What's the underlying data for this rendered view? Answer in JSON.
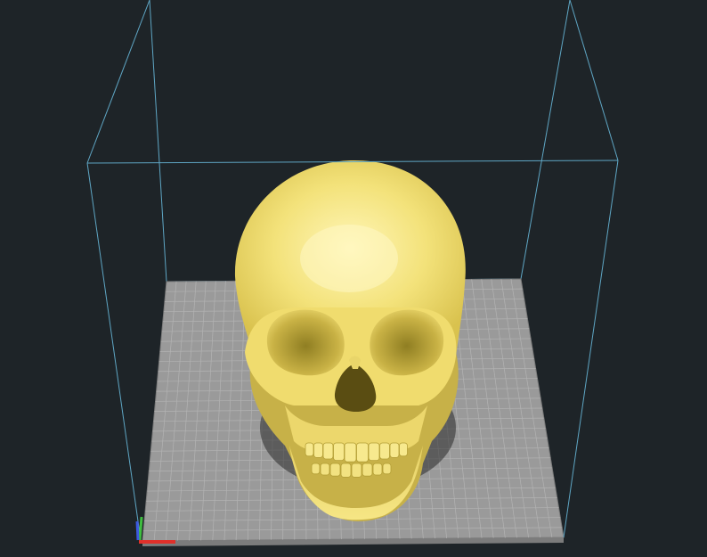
{
  "viewport": {
    "background_color": "#1e2428",
    "build_volume_color": "#5fa6c4",
    "bed_color": "#9a9a9a",
    "bed_edge_color": "#7c7c7c",
    "grid_color": "#b3b3b3",
    "model_color": "#f3e27a",
    "model_highlight_color": "#fff6b8",
    "model_shadow_color": "#b8a43a",
    "model_name": "skull"
  },
  "axis_gizmo": {
    "x_color": "#e0302a",
    "y_color": "#3fbf3f",
    "z_color": "#3d5ae0"
  }
}
